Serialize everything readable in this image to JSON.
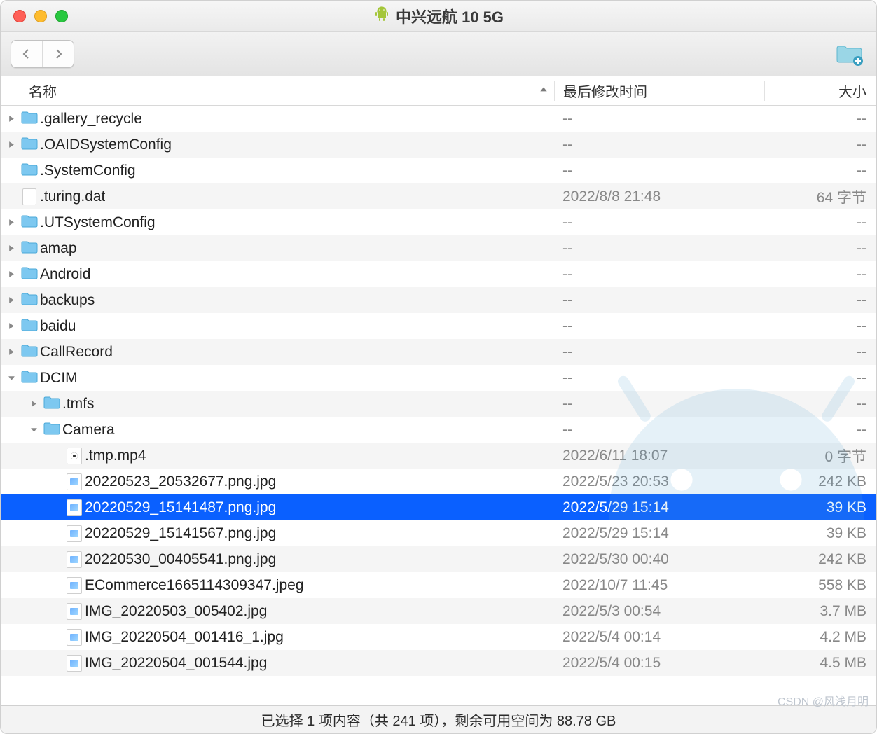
{
  "window": {
    "title": "中兴远航 10 5G"
  },
  "columns": {
    "name": "名称",
    "date": "最后修改时间",
    "size": "大小"
  },
  "rows": [
    {
      "depth": 0,
      "expand": "closed",
      "icon": "folder",
      "name": ".gallery_recycle",
      "date": "--",
      "size": "--",
      "selected": false
    },
    {
      "depth": 0,
      "expand": "closed",
      "icon": "folder",
      "name": ".OAIDSystemConfig",
      "date": "--",
      "size": "--",
      "selected": false
    },
    {
      "depth": 0,
      "expand": "none",
      "icon": "folder",
      "name": ".SystemConfig",
      "date": "--",
      "size": "--",
      "selected": false
    },
    {
      "depth": 0,
      "expand": "none",
      "icon": "file",
      "name": ".turing.dat",
      "date": "2022/8/8 21:48",
      "size": "64 字节",
      "selected": false
    },
    {
      "depth": 0,
      "expand": "closed",
      "icon": "folder",
      "name": ".UTSystemConfig",
      "date": "--",
      "size": "--",
      "selected": false
    },
    {
      "depth": 0,
      "expand": "closed",
      "icon": "folder",
      "name": "amap",
      "date": "--",
      "size": "--",
      "selected": false
    },
    {
      "depth": 0,
      "expand": "closed",
      "icon": "folder",
      "name": "Android",
      "date": "--",
      "size": "--",
      "selected": false
    },
    {
      "depth": 0,
      "expand": "closed",
      "icon": "folder",
      "name": "backups",
      "date": "--",
      "size": "--",
      "selected": false
    },
    {
      "depth": 0,
      "expand": "closed",
      "icon": "folder",
      "name": "baidu",
      "date": "--",
      "size": "--",
      "selected": false
    },
    {
      "depth": 0,
      "expand": "closed",
      "icon": "folder",
      "name": "CallRecord",
      "date": "--",
      "size": "--",
      "selected": false
    },
    {
      "depth": 0,
      "expand": "open",
      "icon": "folder",
      "name": "DCIM",
      "date": "--",
      "size": "--",
      "selected": false
    },
    {
      "depth": 1,
      "expand": "closed",
      "icon": "folder",
      "name": ".tmfs",
      "date": "--",
      "size": "--",
      "selected": false
    },
    {
      "depth": 1,
      "expand": "open",
      "icon": "folder",
      "name": "Camera",
      "date": "--",
      "size": "--",
      "selected": false
    },
    {
      "depth": 2,
      "expand": "none",
      "icon": "video",
      "name": ".tmp.mp4",
      "date": "2022/6/11 18:07",
      "size": "0 字节",
      "selected": false
    },
    {
      "depth": 2,
      "expand": "none",
      "icon": "image",
      "name": "20220523_20532677.png.jpg",
      "date": "2022/5/23 20:53",
      "size": "242 KB",
      "selected": false
    },
    {
      "depth": 2,
      "expand": "none",
      "icon": "image",
      "name": "20220529_15141487.png.jpg",
      "date": "2022/5/29 15:14",
      "size": "39 KB",
      "selected": true
    },
    {
      "depth": 2,
      "expand": "none",
      "icon": "image",
      "name": "20220529_15141567.png.jpg",
      "date": "2022/5/29 15:14",
      "size": "39 KB",
      "selected": false
    },
    {
      "depth": 2,
      "expand": "none",
      "icon": "image",
      "name": "20220530_00405541.png.jpg",
      "date": "2022/5/30 00:40",
      "size": "242 KB",
      "selected": false
    },
    {
      "depth": 2,
      "expand": "none",
      "icon": "image",
      "name": "ECommerce1665114309347.jpeg",
      "date": "2022/10/7 11:45",
      "size": "558 KB",
      "selected": false
    },
    {
      "depth": 2,
      "expand": "none",
      "icon": "image",
      "name": "IMG_20220503_005402.jpg",
      "date": "2022/5/3 00:54",
      "size": "3.7 MB",
      "selected": false
    },
    {
      "depth": 2,
      "expand": "none",
      "icon": "image",
      "name": "IMG_20220504_001416_1.jpg",
      "date": "2022/5/4 00:14",
      "size": "4.2 MB",
      "selected": false
    },
    {
      "depth": 2,
      "expand": "none",
      "icon": "image",
      "name": "IMG_20220504_001544.jpg",
      "date": "2022/5/4 00:15",
      "size": "4.5 MB",
      "selected": false
    }
  ],
  "status": "已选择 1 项内容（共 241 项），剩余可用空间为 88.78 GB",
  "credit": "CSDN @风浅月明"
}
